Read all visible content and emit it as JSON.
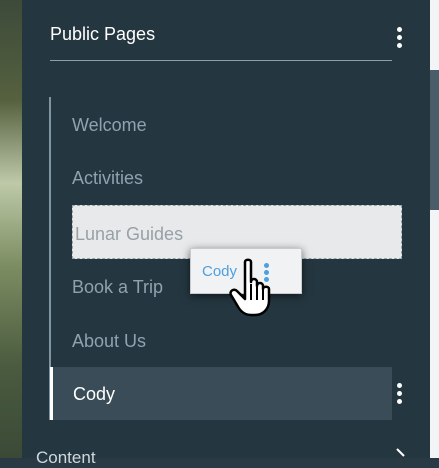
{
  "header": {
    "title": "Public Pages"
  },
  "pages": [
    {
      "label": "Welcome"
    },
    {
      "label": "Activities"
    },
    {
      "label": "Lunar Guides"
    },
    {
      "label": "Book a Trip"
    },
    {
      "label": "About Us"
    },
    {
      "label": "Cody"
    }
  ],
  "drag_ghost": {
    "label": "Cody"
  },
  "footer": {
    "section_label": "Content"
  },
  "colors": {
    "panel_bg": "#243640",
    "selected_bg": "#3a4c57",
    "item_text": "#8ea3af",
    "accent_blue": "#4d9fe0"
  },
  "icons": [
    "more-vertical-icon",
    "hand-pointer-icon",
    "chevron-right-icon"
  ]
}
